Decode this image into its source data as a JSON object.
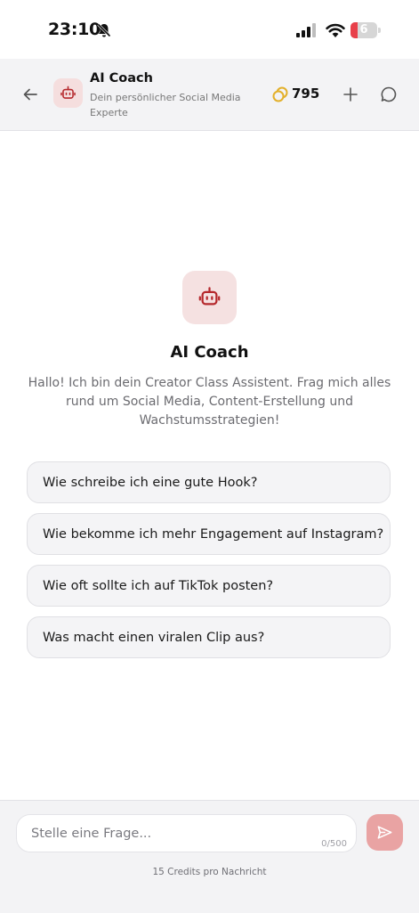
{
  "status_bar": {
    "time": "23:10",
    "battery": "6"
  },
  "header": {
    "title": "AI Coach",
    "subtitle": "Dein persönlicher Social Media Experte",
    "credits": "795"
  },
  "intro": {
    "title": "AI Coach",
    "description": "Hallo! Ich bin dein Creator Class Assistent. Frag mich alles rund um Social Media, Content-Erstellung und Wachstumsstrategien!"
  },
  "suggestions": [
    "Wie schreibe ich eine gute Hook?",
    "Wie bekomme ich mehr Engagement auf Instagram?",
    "Wie oft sollte ich auf TikTok posten?",
    "Was macht einen viralen Clip aus?"
  ],
  "composer": {
    "placeholder": "Stelle eine Frage...",
    "counter": "0/500",
    "note": "15 Credits pro Nachricht"
  },
  "colors": {
    "accent": "#b5282c",
    "accent_soft": "#f5e1e1",
    "send_button": "#e9a3a3",
    "coin": "#e3b02a"
  }
}
